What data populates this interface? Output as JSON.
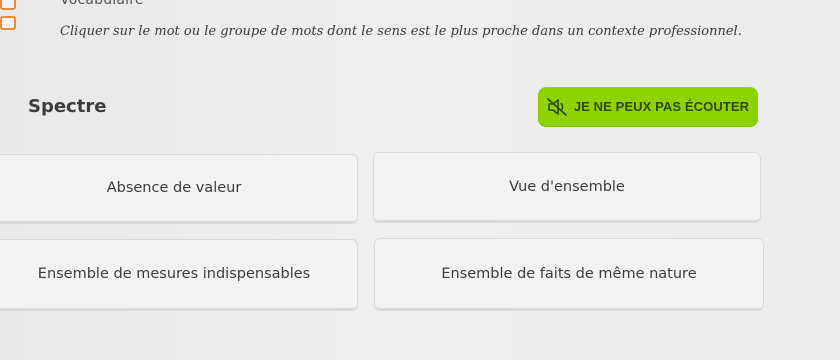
{
  "header": {
    "title": "Vocabulaire",
    "instruction": "Cliquer sur le mot ou le groupe de mots dont le sens est le plus proche dans un contexte professionnel."
  },
  "question": {
    "word": "Spectre"
  },
  "audio": {
    "cant_listen_label": "JE NE PEUX PAS ÉCOUTER",
    "icon": "speaker-muted-icon"
  },
  "options": [
    {
      "label": "Absence de valeur"
    },
    {
      "label": "Vue d'ensemble"
    },
    {
      "label": "Ensemble de mesures indispensables"
    },
    {
      "label": "Ensemble de faits de même nature"
    }
  ],
  "colors": {
    "accent": "#8ed200",
    "accent_text": "#2f4a00",
    "logo": "#e78a3a",
    "background": "#ececed"
  }
}
